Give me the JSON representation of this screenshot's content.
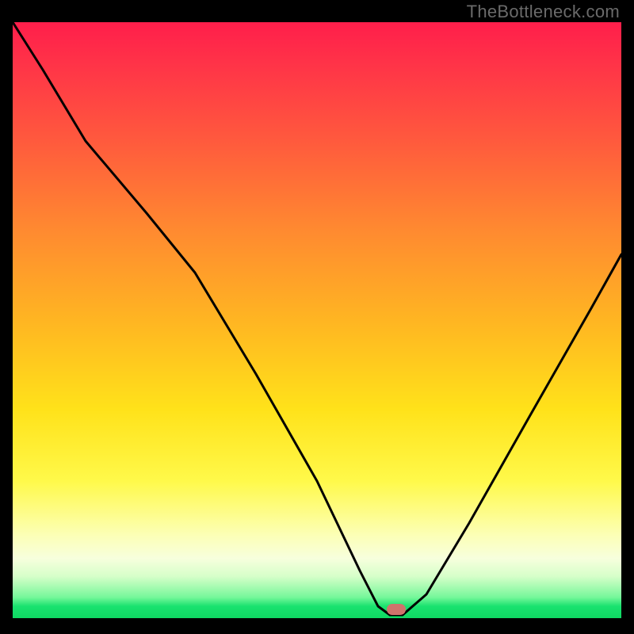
{
  "watermark": "TheBottleneck.com",
  "colors": {
    "page_bg": "#000000",
    "marker": "#d0736c",
    "curve": "#000000",
    "gradient_stops": [
      "#ff1e4b",
      "#ff3647",
      "#ff5a3d",
      "#ff8a30",
      "#ffb522",
      "#ffe21a",
      "#fff94a",
      "#fcffb5",
      "#f7ffdd",
      "#d6ffc9",
      "#76f79a",
      "#19e26f",
      "#0fd862"
    ]
  },
  "chart_data": {
    "type": "line",
    "title": "",
    "xlabel": "",
    "ylabel": "",
    "xlim": [
      0,
      100
    ],
    "ylim": [
      0,
      100
    ],
    "note": "background gradient encodes bottleneck severity (red=high, green=low); curve shows bottleneck % vs an implicit x-axis; dip reaches ~0 near x≈63",
    "marker": {
      "x": 63,
      "y": 1.5
    },
    "series": [
      {
        "name": "bottleneck-curve",
        "x": [
          0,
          5,
          12,
          22,
          30,
          40,
          50,
          57,
          60,
          62,
          64,
          68,
          75,
          85,
          95,
          100
        ],
        "values": [
          100,
          92,
          80,
          68,
          58,
          41,
          23,
          8,
          2,
          0.5,
          0.5,
          4,
          16,
          34,
          52,
          61
        ]
      }
    ]
  }
}
